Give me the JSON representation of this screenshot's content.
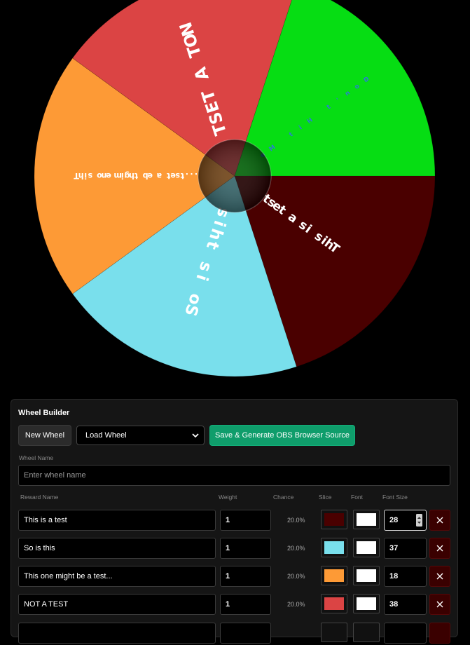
{
  "wheel": {
    "slices": [
      {
        "label": "This is a test",
        "color": "#4a0000",
        "font_color": "#ffffff",
        "font_size": 28
      },
      {
        "label": "So is this",
        "color": "#79dfec",
        "font_color": "#ffffff",
        "font_size": 37
      },
      {
        "label": "This one might be a test...",
        "color": "#fd9a36",
        "font_color": "#ffffff",
        "font_size": 18
      },
      {
        "label": "NOT A TEST",
        "color": "#db4444",
        "font_color": "#ffffff",
        "font_size": 38
      },
      {
        "label": "Don't Hit Me",
        "color": "#06dd13",
        "font_color": "#2b7cd6",
        "font_size": 14
      }
    ]
  },
  "builder": {
    "title": "Wheel Builder",
    "new_wheel_label": "New Wheel",
    "load_wheel_label": "Load Wheel",
    "save_label": "Save & Generate OBS Browser Source",
    "wheel_name_label": "Wheel Name",
    "wheel_name_placeholder": "Enter wheel name",
    "columns": {
      "reward": "Reward Name",
      "weight": "Weight",
      "chance": "Chance",
      "slice": "Slice",
      "font": "Font",
      "font_size": "Font Size"
    },
    "rows": [
      {
        "name": "This is a test",
        "weight": "1",
        "chance": "20.0%",
        "slice_color": "#4a0000",
        "font_color": "#ffffff",
        "font_size": "28"
      },
      {
        "name": "So is this",
        "weight": "1",
        "chance": "20.0%",
        "slice_color": "#79dfec",
        "font_color": "#ffffff",
        "font_size": "37"
      },
      {
        "name": "This one might be a test...",
        "weight": "1",
        "chance": "20.0%",
        "slice_color": "#fd9a36",
        "font_color": "#ffffff",
        "font_size": "18"
      },
      {
        "name": "NOT A TEST",
        "weight": "1",
        "chance": "20.0%",
        "slice_color": "#db4444",
        "font_color": "#ffffff",
        "font_size": "38"
      }
    ]
  }
}
